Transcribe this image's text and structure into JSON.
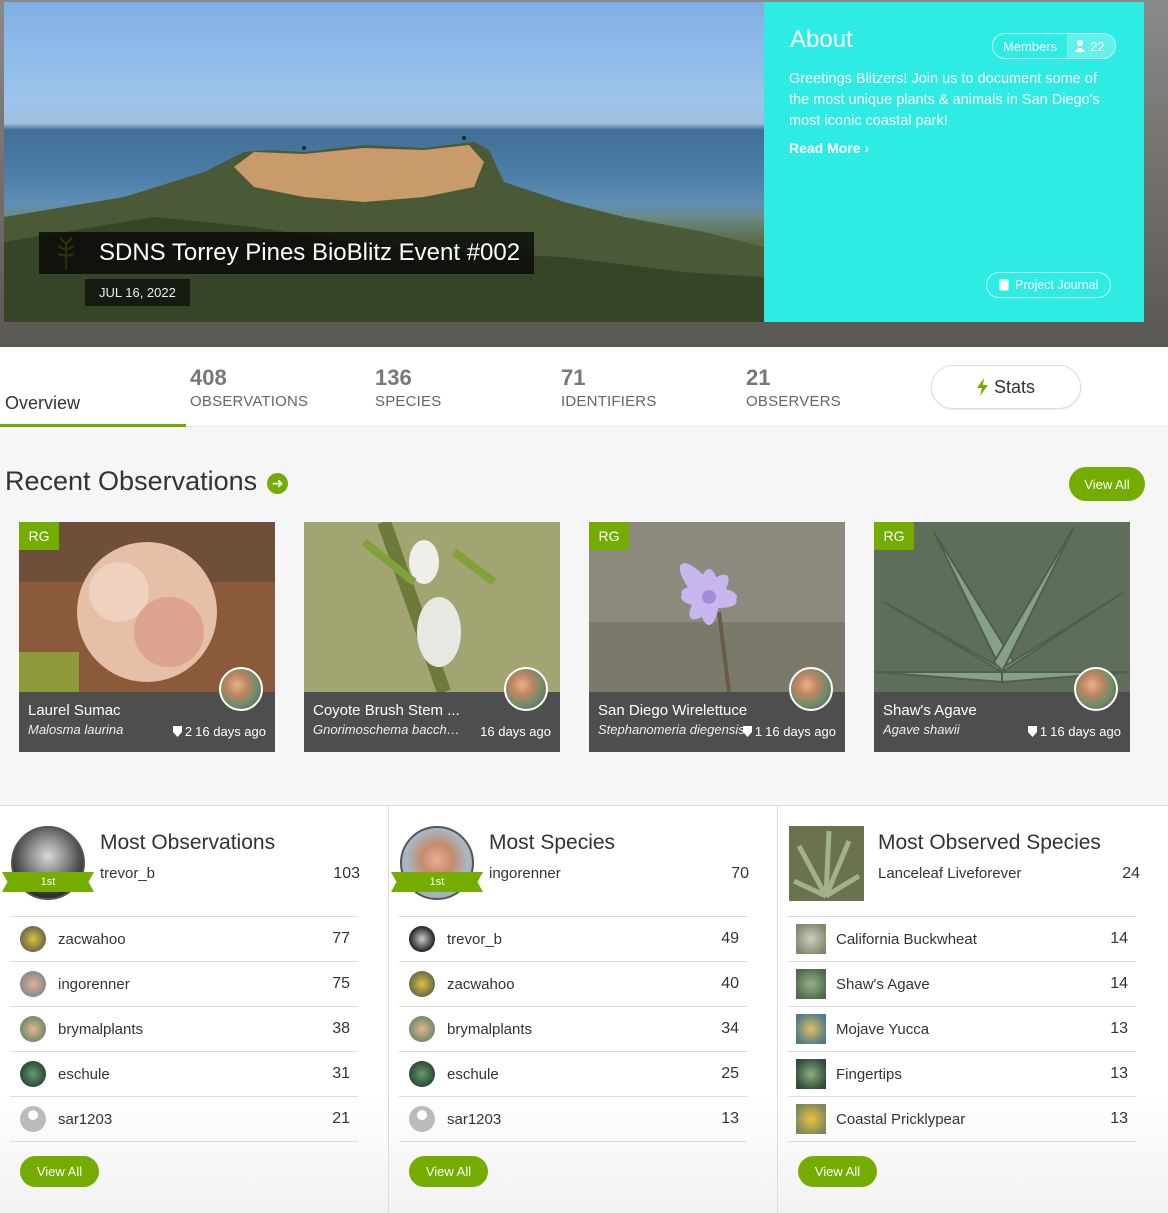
{
  "hero": {
    "title": "SDNS Torrey Pines BioBlitz Event #002",
    "date": "JUL 16, 2022"
  },
  "about": {
    "title": "About",
    "members_label": "Members",
    "members_count": "22",
    "description": "Greetings Blitzers! Join us to document some of the most unique plants & animals in San Diego's most iconic coastal park!",
    "read_more": "Read More ›",
    "journal_label": "Project Journal"
  },
  "stats": {
    "overview_label": "Overview",
    "observations": {
      "num": "408",
      "label": "OBSERVATIONS"
    },
    "species": {
      "num": "136",
      "label": "SPECIES"
    },
    "identifiers": {
      "num": "71",
      "label": "IDENTIFIERS"
    },
    "observers": {
      "num": "21",
      "label": "OBSERVERS"
    },
    "stats_button": "Stats"
  },
  "recent": {
    "heading": "Recent Observations",
    "view_all": "View All",
    "cards": [
      {
        "name": "Laurel Sumac",
        "sci": "Malosma laurina",
        "rg": "RG",
        "ids": "2",
        "age": "16 days ago"
      },
      {
        "name": "Coyote Brush Stem ...",
        "sci": "Gnorimoschema bacchari...",
        "rg": "",
        "ids": "",
        "age": "16 days ago"
      },
      {
        "name": "San Diego Wirelettuce",
        "sci": "Stephanomeria diegensis",
        "rg": "RG",
        "ids": "1",
        "age": "16 days ago"
      },
      {
        "name": "Shaw's Agave",
        "sci": "Agave shawii",
        "rg": "RG",
        "ids": "1",
        "age": "16 days ago"
      }
    ]
  },
  "boards": {
    "most_observations": {
      "title": "Most Observations",
      "leader": {
        "name": "trevor_b",
        "count": "103",
        "rank": "1st"
      },
      "rows": [
        {
          "name": "zacwahoo",
          "count": "77"
        },
        {
          "name": "ingorenner",
          "count": "75"
        },
        {
          "name": "brymalplants",
          "count": "38"
        },
        {
          "name": "eschule",
          "count": "31"
        },
        {
          "name": "sar1203",
          "count": "21"
        }
      ],
      "view_all": "View All"
    },
    "most_species": {
      "title": "Most Species",
      "leader": {
        "name": "ingorenner",
        "count": "70",
        "rank": "1st"
      },
      "rows": [
        {
          "name": "trevor_b",
          "count": "49"
        },
        {
          "name": "zacwahoo",
          "count": "40"
        },
        {
          "name": "brymalplants",
          "count": "34"
        },
        {
          "name": "eschule",
          "count": "25"
        },
        {
          "name": "sar1203",
          "count": "13"
        }
      ],
      "view_all": "View All"
    },
    "most_observed_species": {
      "title": "Most Observed Species",
      "leader": {
        "name": "Lanceleaf Liveforever",
        "count": "24"
      },
      "rows": [
        {
          "name": "California Buckwheat",
          "count": "14"
        },
        {
          "name": "Shaw's Agave",
          "count": "14"
        },
        {
          "name": "Mojave Yucca",
          "count": "13"
        },
        {
          "name": "Fingertips",
          "count": "13"
        },
        {
          "name": "Coastal Pricklypear",
          "count": "13"
        }
      ],
      "view_all": "View All"
    }
  },
  "colors": {
    "accent": "#74ac00",
    "about_bg": "#2eece4"
  }
}
